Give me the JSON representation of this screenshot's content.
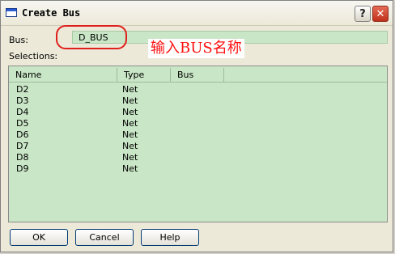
{
  "window": {
    "title": "Create Bus",
    "help_glyph": "?",
    "close_glyph": "✕"
  },
  "form": {
    "bus_label": "Bus:",
    "bus_value": "D_BUS",
    "selections_label": "Selections:",
    "annotation": "输入BUS名称"
  },
  "list": {
    "columns": [
      "Name",
      "Type",
      "Bus"
    ],
    "rows": [
      {
        "name": "D2",
        "type": "Net",
        "bus": ""
      },
      {
        "name": "D3",
        "type": "Net",
        "bus": ""
      },
      {
        "name": "D4",
        "type": "Net",
        "bus": ""
      },
      {
        "name": "D5",
        "type": "Net",
        "bus": ""
      },
      {
        "name": "D6",
        "type": "Net",
        "bus": ""
      },
      {
        "name": "D7",
        "type": "Net",
        "bus": ""
      },
      {
        "name": "D8",
        "type": "Net",
        "bus": ""
      },
      {
        "name": "D9",
        "type": "Net",
        "bus": ""
      }
    ]
  },
  "buttons": {
    "ok": "OK",
    "cancel": "Cancel",
    "help": "Help"
  },
  "icons": {
    "app": "window-icon",
    "help": "help-icon",
    "close": "close-icon"
  }
}
